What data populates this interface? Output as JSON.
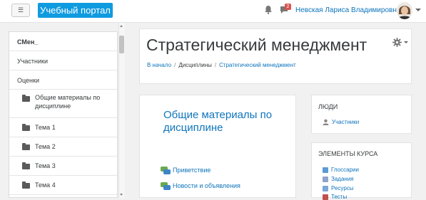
{
  "navbar": {
    "menu_icon": "hamburger-icon",
    "brand": "Учебный портал",
    "notifications_icon": "bell-icon",
    "messages_icon": "chat-icon",
    "messages_badge": "2",
    "user_name": "Невская Лариса Владимировна",
    "brand_color": "#0f9be0"
  },
  "drawer": {
    "items": [
      {
        "label": "СМен_",
        "bold": true
      },
      {
        "label": "Участники"
      },
      {
        "label": "Оценки"
      },
      {
        "label": "Общие материалы по дисциплине",
        "icon": "folder-icon"
      },
      {
        "label": "Тема 1",
        "icon": "folder-icon"
      },
      {
        "label": "Тема 2",
        "icon": "folder-icon"
      },
      {
        "label": "Тема 3",
        "icon": "folder-icon"
      },
      {
        "label": "Тема 4",
        "icon": "folder-icon"
      }
    ]
  },
  "header": {
    "title": "Стратегический менеджмент",
    "breadcrumb": [
      "В начало",
      "Дисциплины",
      "Стратегический менеджмент"
    ],
    "settings_icon": "gear-icon"
  },
  "main": {
    "section_title": "Общие материалы по дисциплине",
    "activities": [
      {
        "label": "Приветствие",
        "icon": "forum-icon"
      },
      {
        "label": "Новости и объявления",
        "icon": "forum-icon"
      }
    ]
  },
  "blocks": {
    "people": {
      "title": "ЛЮДИ",
      "link": "Участники",
      "icon": "user-icon"
    },
    "course_elements": {
      "title": "ЭЛЕМЕНТЫ КУРСА",
      "items": [
        {
          "label": "Глоссарии",
          "icon": "glossary-icon"
        },
        {
          "label": "Задания",
          "icon": "assignment-icon"
        },
        {
          "label": "Ресурсы",
          "icon": "resource-icon"
        },
        {
          "label": "Тесты",
          "icon": "quiz-icon"
        }
      ]
    }
  }
}
